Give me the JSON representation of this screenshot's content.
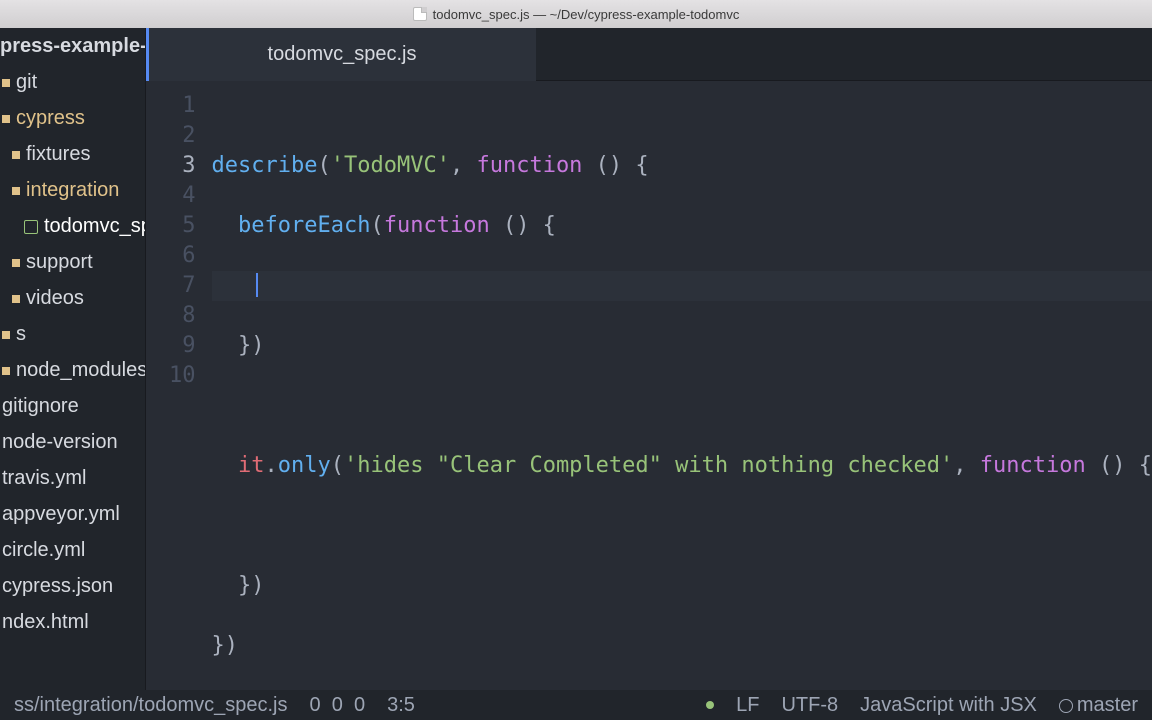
{
  "window": {
    "title": "todomvc_spec.js — ~/Dev/cypress-example-todomvc"
  },
  "sidebar": {
    "items": [
      {
        "label": "press-example-todomvc",
        "kind": "root",
        "depth": 0
      },
      {
        "label": "git",
        "kind": "folder",
        "depth": 1
      },
      {
        "label": "cypress",
        "kind": "folder",
        "depth": 1,
        "open": true
      },
      {
        "label": "fixtures",
        "kind": "folder",
        "depth": 2
      },
      {
        "label": "integration",
        "kind": "folder",
        "depth": 2,
        "open": true
      },
      {
        "label": "todomvc_spec.js",
        "kind": "file",
        "depth": 3,
        "selected": true
      },
      {
        "label": "support",
        "kind": "folder",
        "depth": 2
      },
      {
        "label": "videos",
        "kind": "folder",
        "depth": 2
      },
      {
        "label": "s",
        "kind": "folder",
        "depth": 1
      },
      {
        "label": "node_modules",
        "kind": "folder",
        "depth": 1
      },
      {
        "label": "gitignore",
        "kind": "file",
        "depth": 1
      },
      {
        "label": "node-version",
        "kind": "file",
        "depth": 1
      },
      {
        "label": "travis.yml",
        "kind": "file",
        "depth": 1
      },
      {
        "label": "appveyor.yml",
        "kind": "file",
        "depth": 1
      },
      {
        "label": "circle.yml",
        "kind": "file",
        "depth": 1
      },
      {
        "label": "cypress.json",
        "kind": "file",
        "depth": 1
      },
      {
        "label": "ndex.html",
        "kind": "file",
        "depth": 1
      }
    ]
  },
  "tabs": [
    {
      "label": "todomvc_spec.js",
      "active": true
    }
  ],
  "code": {
    "lines": [
      {
        "n": 1
      },
      {
        "n": 2
      },
      {
        "n": 3,
        "current": true
      },
      {
        "n": 4
      },
      {
        "n": 5
      },
      {
        "n": 6
      },
      {
        "n": 7
      },
      {
        "n": 8
      },
      {
        "n": 9
      },
      {
        "n": 10
      }
    ],
    "tokens": {
      "l1_describe": "describe",
      "l1_open": "(",
      "l1_str": "'TodoMVC'",
      "l1_comma": ", ",
      "l1_function": "function",
      "l1_parens": " () {",
      "l2_beforeEach": "  beforeEach",
      "l2_open": "(",
      "l2_function": "function",
      "l2_parens": " () {",
      "l3_invis": "    ",
      "l4_close": "  })",
      "l5_blank": "",
      "l6_indent": "  ",
      "l6_it": "it",
      "l6_dot": ".",
      "l6_only": "only",
      "l6_open": "(",
      "l6_str": "'hides \"Clear Completed\" with nothing checked'",
      "l6_comma": ", ",
      "l6_function": "function",
      "l6_parens": " () {",
      "l7_blank": "",
      "l8_close": "  })",
      "l9_close": "})"
    }
  },
  "status": {
    "path": "ss/integration/todomvc_spec.js",
    "diag1": "0",
    "diag2": "0",
    "diag3": "0",
    "cursor": "3:5",
    "line_ending": "LF",
    "encoding": "UTF-8",
    "grammar": "JavaScript with JSX",
    "branch": "master"
  }
}
